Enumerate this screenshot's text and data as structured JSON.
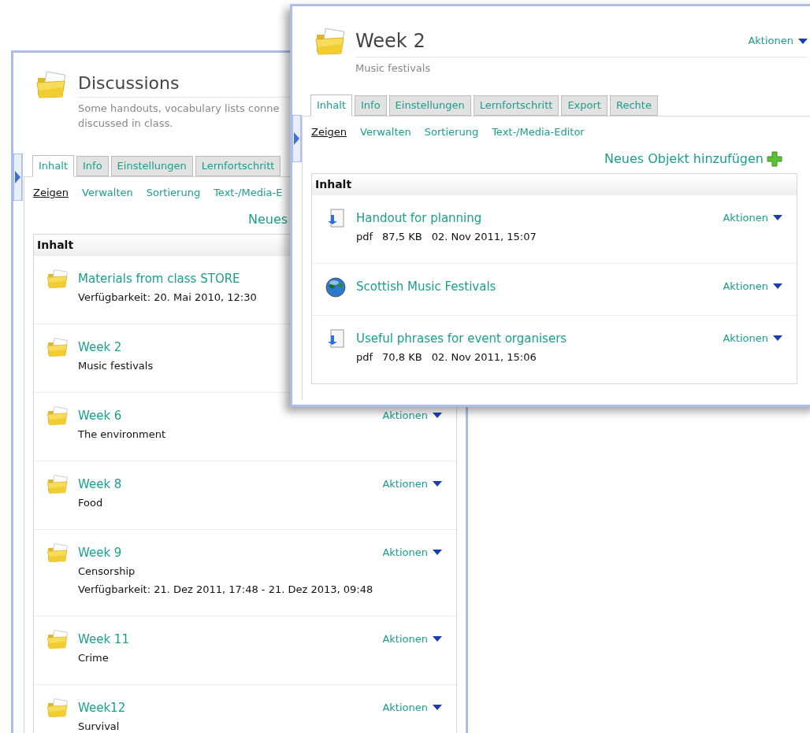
{
  "back_window": {
    "title": "Discussions",
    "description": [
      "Some handouts, vocabulary lists conne",
      "discussed in class."
    ],
    "tabs": [
      {
        "label": "Inhalt",
        "selected": true
      },
      {
        "label": "Info",
        "selected": false
      },
      {
        "label": "Einstellungen",
        "selected": false
      },
      {
        "label": "Lernfortschritt",
        "selected": false
      }
    ],
    "subtabs": [
      {
        "label": "Zeigen",
        "selected": true
      },
      {
        "label": "Verwalten",
        "selected": false
      },
      {
        "label": "Sortierung",
        "selected": false
      },
      {
        "label": "Text-/Media-E",
        "selected": false
      }
    ],
    "add": {
      "label": "Neues",
      "icon": false
    },
    "table": {
      "header": "Inhalt",
      "items": [
        {
          "kind": "folder",
          "name": "Materials from class STORE",
          "lines": [
            "Verfügbarkeit: 20. Mai 2010, 12:30"
          ]
        },
        {
          "kind": "folder",
          "name": "Week 2",
          "lines": [
            "Music festivals"
          ]
        },
        {
          "kind": "folder",
          "name": "Week 6",
          "lines": [
            "The environment"
          ],
          "actions": "Aktionen"
        },
        {
          "kind": "folder",
          "name": "Week 8",
          "lines": [
            "Food"
          ],
          "actions": "Aktionen"
        },
        {
          "kind": "folder",
          "name": "Week 9",
          "lines": [
            "Censorship",
            "Verfügbarkeit: 21. Dez 2011, 17:48 - 21. Dez 2013, 09:48"
          ],
          "actions": "Aktionen"
        },
        {
          "kind": "folder",
          "name": "Week 11",
          "lines": [
            "Crime"
          ],
          "actions": "Aktionen"
        },
        {
          "kind": "folder",
          "name": "Week12",
          "lines": [
            "Survival"
          ],
          "actions": "Aktionen"
        }
      ]
    }
  },
  "front_window": {
    "title": "Week 2",
    "actions": "Aktionen",
    "description": [
      "Music festivals"
    ],
    "tabs": [
      {
        "label": "Inhalt",
        "selected": true
      },
      {
        "label": "Info",
        "selected": false
      },
      {
        "label": "Einstellungen",
        "selected": false
      },
      {
        "label": "Lernfortschritt",
        "selected": false
      },
      {
        "label": "Export",
        "selected": false
      },
      {
        "label": "Rechte",
        "selected": false
      }
    ],
    "subtabs": [
      {
        "label": "Zeigen",
        "selected": true
      },
      {
        "label": "Verwalten",
        "selected": false
      },
      {
        "label": "Sortierung",
        "selected": false
      },
      {
        "label": "Text-/Media-Editor",
        "selected": false
      }
    ],
    "add": {
      "label": "Neues Objekt hinzufügen",
      "icon": true
    },
    "table": {
      "header": "Inhalt",
      "items": [
        {
          "kind": "file",
          "name": "Handout for planning",
          "details": [
            "pdf",
            "87,5 KB",
            "02. Nov 2011, 15:07"
          ],
          "actions": "Aktionen"
        },
        {
          "kind": "link",
          "name": "Scottish Music Festivals",
          "actions": "Aktionen"
        },
        {
          "kind": "file",
          "name": "Useful phrases for event organisers",
          "details": [
            "pdf",
            "70,8 KB",
            "02. Nov 2011, 15:06"
          ],
          "actions": "Aktionen"
        }
      ]
    }
  }
}
